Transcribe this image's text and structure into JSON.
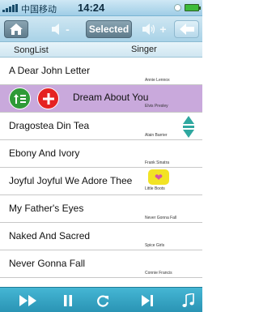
{
  "statusbar": {
    "carrier": "中国移动",
    "time": "14:24"
  },
  "toolbar": {
    "selected_label": "Selected",
    "vol_down": "-",
    "vol_up": "+"
  },
  "header": {
    "songlist_label": "SongList",
    "singer_label": "Singer"
  },
  "songs": [
    {
      "title": "A Dear John Letter",
      "singer": "Annie Lennox"
    },
    {
      "title": "Dream About You",
      "singer": "Elvis Presley",
      "selected": true
    },
    {
      "title": "Dragostea Din Tea",
      "singer": "Alain Barrier"
    },
    {
      "title": "Ebony And Ivory",
      "singer": "Frank Sinatra"
    },
    {
      "title": "Joyful Joyful We Adore Thee",
      "singer": "Little Boots"
    },
    {
      "title": "My Father's Eyes",
      "singer": "Never Gonna Fall"
    },
    {
      "title": "Naked And Sacred",
      "singer": "Spice Girls"
    },
    {
      "title": "Never Gonna Fall",
      "singer": "Connie Francis"
    }
  ],
  "icons": {
    "home": "home-icon",
    "vol_down": "speaker-minus-icon",
    "vol_up": "speaker-plus-icon",
    "back": "back-arrow-icon",
    "move": "move-up-list-icon",
    "add": "plus-icon",
    "scroll": "scroll-handle-icon",
    "favorite": "heart-icon",
    "next": "fast-forward-icon",
    "pause": "pause-icon",
    "repeat": "repeat-icon",
    "skip": "skip-next-icon",
    "playlist": "music-list-icon"
  },
  "colors": {
    "selected_row": "#c9a9dc",
    "move_button": "#2f9a38",
    "add_button": "#e52222",
    "player_bar": "#2fa0c0",
    "favorite_badge": "#f2e324",
    "heart": "#d455a6"
  }
}
